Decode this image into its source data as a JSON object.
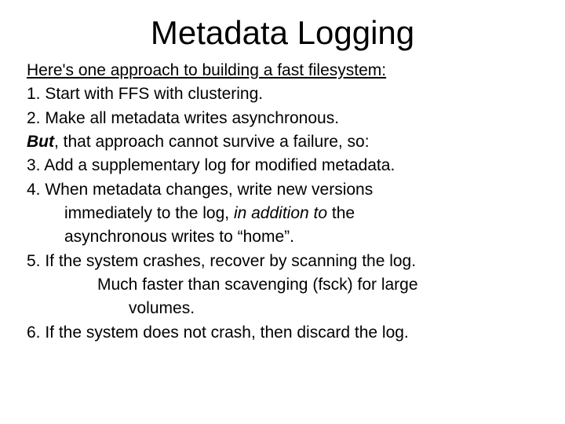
{
  "title": "Metadata Logging",
  "lead": "Here's one approach to building a fast filesystem:",
  "li1": "1. Start with FFS with clustering.",
  "li2": "2. Make all metadata writes asynchronous.",
  "but_word": "But",
  "but_rest": ", that approach cannot survive a failure, so:",
  "li3": "3. Add a supplementary log for modified metadata.",
  "li4a": "4. When metadata changes, write new versions",
  "li4b_pre": "immediately to the log, ",
  "li4b_em": "in addition to",
  "li4b_post": " the",
  "li4c": "asynchronous writes to “home”.",
  "li5": "5. If the system crashes, recover by scanning the log.",
  "note_a": "Much faster than scavenging (fsck) for large",
  "note_b": "volumes.",
  "li6": "6. If the system does not crash, then discard the log."
}
